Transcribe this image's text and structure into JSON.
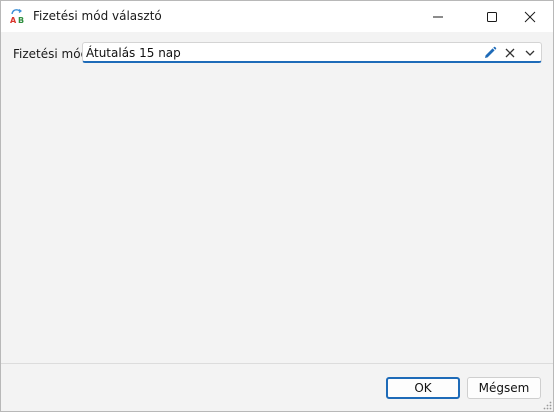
{
  "window": {
    "title": "Fizetési mód választó",
    "icon": "ab-text-icon",
    "controls": {
      "minimize": "minimize-icon",
      "maximize": "maximize-icon",
      "close": "close-icon"
    }
  },
  "form": {
    "payment_label": "Fizetési mód:",
    "payment_value": "Átutalás 15 nap",
    "icons": [
      "pencil-icon",
      "clear-x-icon",
      "chevron-down-icon"
    ]
  },
  "footer": {
    "ok_label": "OK",
    "cancel_label": "Mégsem"
  },
  "colors": {
    "accent": "#1e6bb8",
    "background": "#f3f3f3",
    "titlebar": "#ffffff"
  }
}
